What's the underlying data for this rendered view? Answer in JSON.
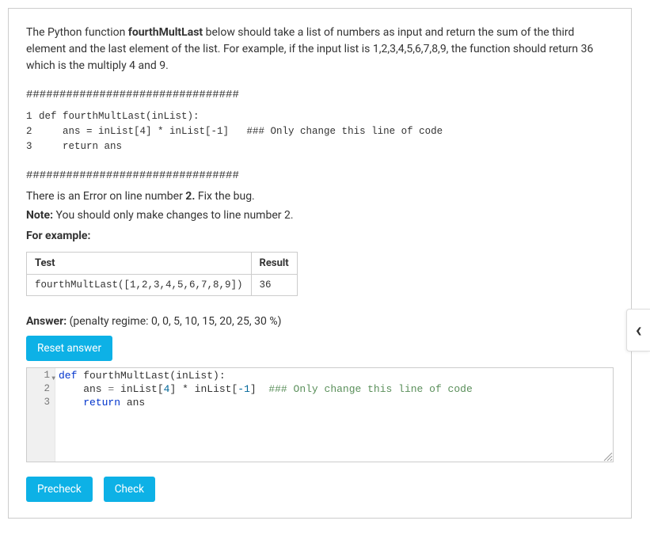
{
  "description": {
    "prefix": "The Python function ",
    "funcname": "fourthMultLast",
    "suffix": " below should take a list of numbers as input and return the sum of the third element and the last element of the list. For example, if the input list is 1,2,3,4,5,6,7,8,9, the function should return 36 which is the multiply 4 and 9."
  },
  "divider": "################################",
  "refcode": {
    "l1": "def fourthMultLast(inList):",
    "l2": "    ans = inList[4] * inList[-1]   ### Only change this line of code",
    "l3": "    return ans"
  },
  "error_prefix": "There is an Error on line number ",
  "error_line": "2.",
  "error_suffix": " Fix the bug.",
  "note_label": "Note:",
  "note_text": " You should only make changes to line number 2.",
  "for_example": "For example:",
  "table": {
    "h1": "Test",
    "h2": "Result",
    "r1c1": "fourthMultLast([1,2,3,4,5,6,7,8,9])",
    "r1c2": "36"
  },
  "answer_label": "Answer:",
  "penalty": " (penalty regime: 0, 0, 5, 10, 15, 20, 25, 30 %)",
  "reset_btn": "Reset answer",
  "editor": {
    "line1_kw": "def",
    "line1_rest": " fourthMultLast(inList):",
    "line2_indent": "    ans ",
    "line2_eq": "=",
    "line2_a": " inList[",
    "line2_n1": "4",
    "line2_b": "] * inList[",
    "line2_n2": "-1",
    "line2_c": "]  ",
    "line2_comment": "### Only change this line of code",
    "line3_indent": "    ",
    "line3_kw": "return",
    "line3_rest": " ans"
  },
  "precheck_btn": "Precheck",
  "check_btn": "Check",
  "chev": "‹"
}
